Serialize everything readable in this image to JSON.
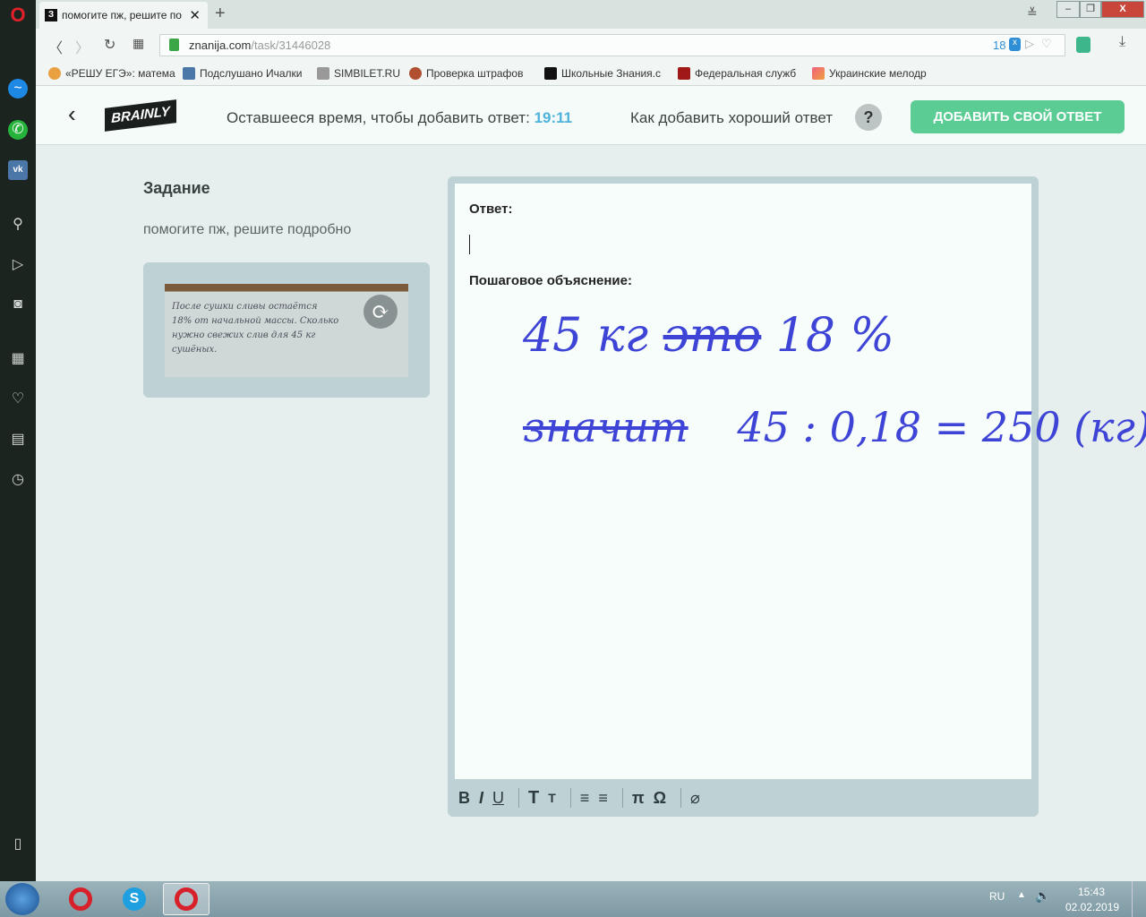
{
  "browser": {
    "tab_title": "помогите пж, решите по",
    "tab_favicon": "З",
    "url_domain": "znanija.com",
    "url_path": "/task/31446028",
    "blocked_count": "18",
    "bookmarks": [
      "«РЕШУ ЕГЭ»: матема",
      "Подслушано Ичалки",
      "SIMBILET.RU",
      "Проверка штрафов",
      "Школьные Знания.c",
      "Федеральная служб",
      "Украинские мелодр"
    ]
  },
  "header": {
    "logo": "BRAINLY",
    "timer_label": "Оставшееся время, чтобы добавить ответ:",
    "timer_value": "19:11",
    "howto": "Как добавить хороший ответ",
    "help": "?",
    "add_answer": "ДОБАВИТЬ СВОЙ ОТВЕТ",
    "accent": "#5ccc95"
  },
  "task": {
    "title": "Задание",
    "text": "помогите пж, решите подробно",
    "photo_lines": [
      "После сушки сливы остаётся",
      "18% от начальной массы. Сколько",
      "нужно свежих слив для 45 кг",
      "сушёных."
    ]
  },
  "editor": {
    "answer_label": "Ответ:",
    "explanation_label": "Пошаговое объяснение:",
    "handwriting": {
      "line1a": "45 кг",
      "line1_struck": "это",
      "line1b": "18 %",
      "line2a": "значит",
      "line2b": "45 : 0,18 = 250 (кг)",
      "ink": "#3e44d6"
    },
    "toolbar": [
      "B",
      "I",
      "U",
      "T",
      "T",
      "≡",
      "≡",
      "π",
      "Ω",
      "⌀"
    ]
  },
  "taskbar": {
    "lang": "RU",
    "time": "15:43",
    "date": "02.02.2019"
  }
}
